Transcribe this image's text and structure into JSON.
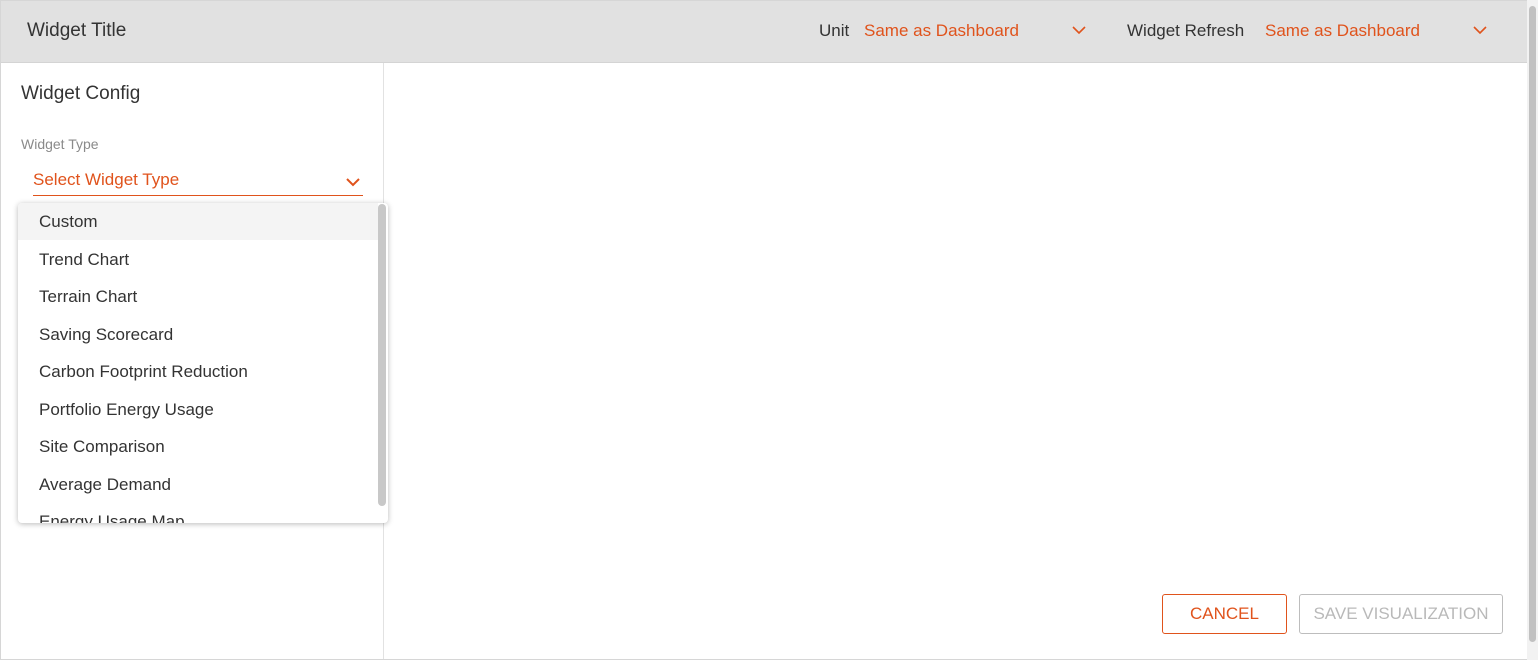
{
  "header": {
    "title": "Widget Title",
    "unit_label": "Unit",
    "unit_value": "Same as Dashboard",
    "refresh_label": "Widget Refresh",
    "refresh_value": "Same as Dashboard"
  },
  "config": {
    "heading": "Widget Config",
    "widget_type_label": "Widget Type",
    "widget_type_placeholder": "Select Widget Type"
  },
  "dropdown": {
    "options": [
      "Custom",
      "Trend Chart",
      "Terrain Chart",
      "Saving Scorecard",
      "Carbon Footprint Reduction",
      "Portfolio Energy Usage",
      "Site Comparison",
      "Average Demand",
      "Energy Usage Map"
    ],
    "highlighted_index": 0
  },
  "actions": {
    "cancel_label": "CANCEL",
    "save_label": "SAVE VISUALIZATION"
  },
  "colors": {
    "accent": "#e0531c",
    "header_bg": "#e1e1e1",
    "disabled_text": "#b9b9b9"
  },
  "icons": {
    "dropdown_chevron": "chevron-down-icon"
  }
}
